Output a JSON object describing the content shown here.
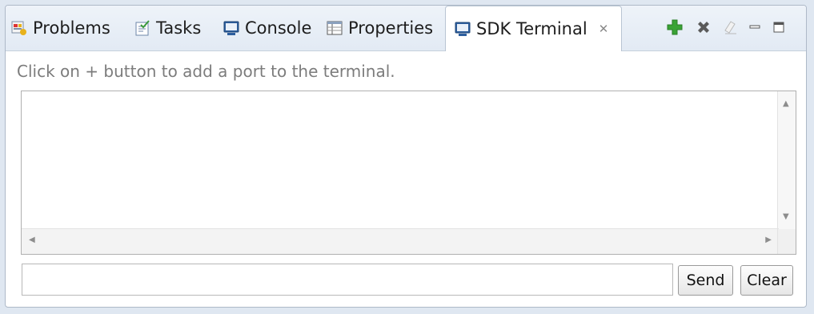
{
  "tabs": [
    {
      "label": "Problems",
      "icon": "problems-icon"
    },
    {
      "label": "Tasks",
      "icon": "tasks-icon"
    },
    {
      "label": "Console",
      "icon": "console-icon"
    },
    {
      "label": "Properties",
      "icon": "properties-icon"
    },
    {
      "label": "SDK Terminal",
      "icon": "terminal-icon",
      "active": true,
      "close_glyph": "✕"
    }
  ],
  "toolbar": {
    "add_icon": "add-port-icon",
    "remove_icon": "remove-port-icon",
    "clear_icon": "clear-console-icon",
    "minimize_icon": "minimize-icon",
    "maximize_icon": "maximize-icon"
  },
  "main": {
    "hint": "Click on + button to add a port to the terminal.",
    "output_text": "",
    "input_value": "",
    "send_label": "Send",
    "clear_label": "Clear"
  },
  "colors": {
    "add": "#3aa335",
    "remove": "#5a5a5a",
    "tab_bar": "#e6edf5",
    "hint_text": "#7c7c7c"
  }
}
